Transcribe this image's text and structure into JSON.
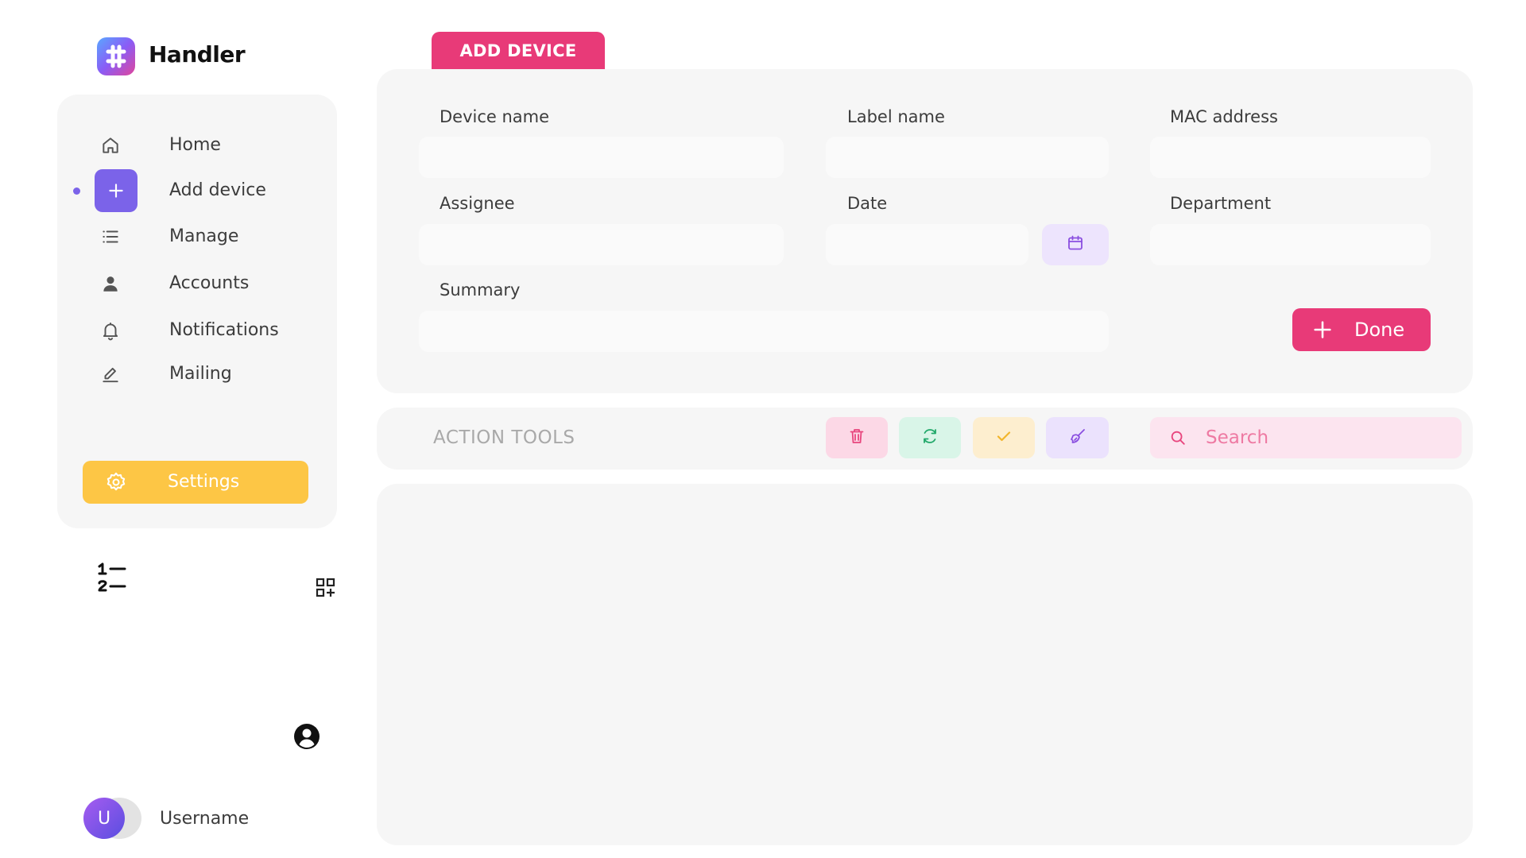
{
  "brand": {
    "name": "Handler"
  },
  "sidebar": {
    "items": [
      {
        "label": "Home",
        "icon": "home-icon"
      },
      {
        "label": "Add device",
        "icon": "plus-icon",
        "active": true
      },
      {
        "label": "Manage",
        "icon": "list-icon"
      },
      {
        "label": "Accounts",
        "icon": "person-icon"
      },
      {
        "label": "Notifications",
        "icon": "bell-icon"
      },
      {
        "label": "Mailing",
        "icon": "pencil-icon"
      }
    ],
    "settings_label": "Settings",
    "active_color": "#7b63e9",
    "settings_color": "#fdc645"
  },
  "user": {
    "avatar_initial": "U",
    "username": "Username"
  },
  "tab": {
    "label": "ADD DEVICE"
  },
  "form": {
    "device_name_label": "Device name",
    "label_name_label": "Label name",
    "mac_label": "MAC address",
    "assignee_label": "Assignee",
    "date_label": "Date",
    "department_label": "Department",
    "summary_label": "Summary",
    "done_label": "Done",
    "accent": "#e83a78"
  },
  "tools": {
    "title": "ACTION TOOLS",
    "search_placeholder": "Search",
    "buttons": [
      "trash-icon",
      "refresh-icon",
      "check-icon",
      "clear-icon"
    ]
  }
}
